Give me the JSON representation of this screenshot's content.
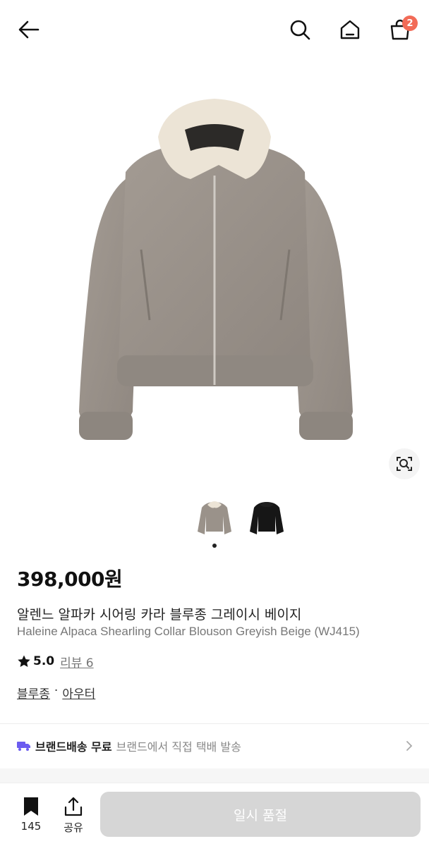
{
  "header": {
    "cart_count": "2"
  },
  "icons": {
    "back": "arrow-left-icon",
    "search": "search-icon",
    "home": "home-icon",
    "cart": "shopping-bag-icon",
    "lens": "image-search-icon",
    "bookmark": "bookmark-icon",
    "share": "share-icon",
    "truck": "truck-icon",
    "chevron": "chevron-right-icon"
  },
  "product": {
    "price": "398,000원",
    "name_ko": "알렌느 알파카 시어링 카라 블루종 그레이시 베이지",
    "name_en": "Haleine Alpaca Shearling Collar Blouson Greyish Beige (WJ415)",
    "rating": "5.0",
    "reviews_label": "리뷰 6",
    "categories": [
      "블루종",
      "아우터"
    ],
    "category_sep": "·"
  },
  "thumbnails": [
    {
      "color": "#9a928a",
      "name": "grey-beige"
    },
    {
      "color": "#161616",
      "name": "black"
    }
  ],
  "shipping": {
    "title": "브랜드배송 무료",
    "desc": "브랜드에서 직접 택배 발송"
  },
  "bottom": {
    "bookmark_count": "145",
    "share_label": "공유",
    "soldout_label": "일시 품절"
  },
  "colors": {
    "badge": "#f26b57",
    "truck": "#6b5cf0",
    "soldout_bg": "#d6d6d6"
  }
}
